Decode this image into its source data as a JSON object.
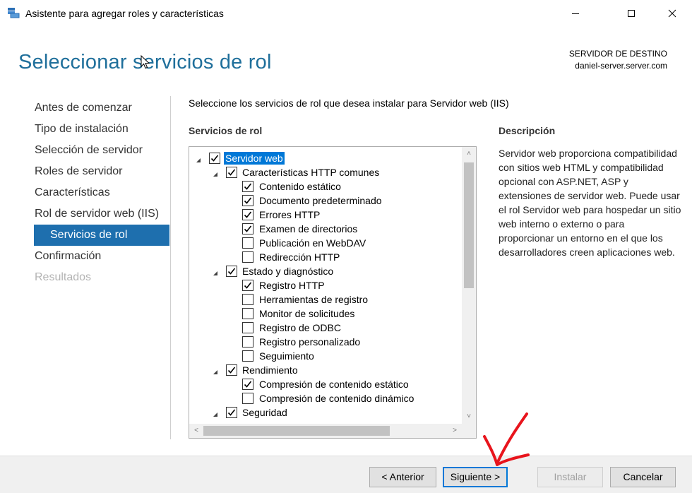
{
  "window": {
    "title": "Asistente para agregar roles y características",
    "app_icon": "server-manager-icon"
  },
  "header": {
    "page_title": "Seleccionar servicios de rol",
    "destination_label": "SERVIDOR DE DESTINO",
    "destination_server": "daniel-server.server.com"
  },
  "nav": {
    "items": [
      {
        "label": "Antes de comenzar"
      },
      {
        "label": "Tipo de instalación"
      },
      {
        "label": "Selección de servidor"
      },
      {
        "label": "Roles de servidor"
      },
      {
        "label": "Características"
      },
      {
        "label": "Rol de servidor web (IIS)"
      },
      {
        "label": "Servicios de rol"
      },
      {
        "label": "Confirmación"
      },
      {
        "label": "Resultados"
      }
    ]
  },
  "main": {
    "instruction": "Seleccione los servicios de rol que desea instalar para Servidor web (IIS)",
    "services_label": "Servicios de rol",
    "description_label": "Descripción",
    "description_text": "Servidor web proporciona compatibilidad con sitios web HTML y compatibilidad opcional con ASP.NET, ASP y extensiones de servidor web. Puede usar el rol Servidor web para hospedar un sitio web interno o externo o para proporcionar un entorno en el que los desarrolladores creen aplicaciones web."
  },
  "tree": {
    "rows": [
      {
        "label": "Servidor web",
        "checked": true,
        "level": 0,
        "expandable": true,
        "selected": true
      },
      {
        "label": "Características HTTP comunes",
        "checked": true,
        "level": 1,
        "expandable": true
      },
      {
        "label": "Contenido estático",
        "checked": true,
        "level": 2
      },
      {
        "label": "Documento predeterminado",
        "checked": true,
        "level": 2
      },
      {
        "label": "Errores HTTP",
        "checked": true,
        "level": 2
      },
      {
        "label": "Examen de directorios",
        "checked": true,
        "level": 2
      },
      {
        "label": "Publicación en WebDAV",
        "checked": false,
        "level": 2
      },
      {
        "label": "Redirección HTTP",
        "checked": false,
        "level": 2
      },
      {
        "label": "Estado y diagnóstico",
        "checked": true,
        "level": 1,
        "expandable": true
      },
      {
        "label": "Registro HTTP",
        "checked": true,
        "level": 2
      },
      {
        "label": "Herramientas de registro",
        "checked": false,
        "level": 2
      },
      {
        "label": "Monitor de solicitudes",
        "checked": false,
        "level": 2
      },
      {
        "label": "Registro de ODBC",
        "checked": false,
        "level": 2
      },
      {
        "label": "Registro personalizado",
        "checked": false,
        "level": 2
      },
      {
        "label": "Seguimiento",
        "checked": false,
        "level": 2
      },
      {
        "label": "Rendimiento",
        "checked": true,
        "level": 1,
        "expandable": true
      },
      {
        "label": "Compresión de contenido estático",
        "checked": true,
        "level": 2
      },
      {
        "label": "Compresión de contenido dinámico",
        "checked": false,
        "level": 2
      },
      {
        "label": "Seguridad",
        "checked": true,
        "level": 1,
        "expandable": true
      }
    ]
  },
  "footer": {
    "back_label": "< Anterior",
    "next_label": "Siguiente >",
    "install_label": "Instalar",
    "cancel_label": "Cancelar"
  },
  "colors": {
    "title_accent": "#1f6f9b",
    "nav_active": "#1e6fae",
    "selection": "#0078d7",
    "annotation_red": "#e8141c"
  }
}
